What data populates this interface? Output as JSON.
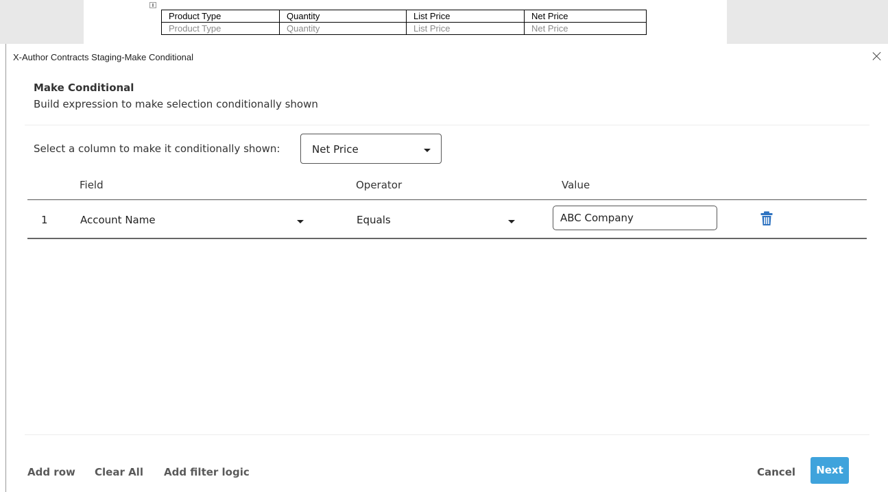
{
  "document": {
    "table": [
      [
        "Product Type",
        "Quantity",
        "List Price",
        "Net Price"
      ],
      [
        "Product Type",
        "Quantity",
        "List Price",
        "Net Price"
      ]
    ]
  },
  "dialog": {
    "title": "X-Author Contracts Staging-Make Conditional",
    "heading": "Make Conditional",
    "subheading": "Build expression to make selection conditionally shown",
    "column_label": "Select a column to make it conditionally shown:",
    "column_selected": "Net Price",
    "headers": {
      "field": "Field",
      "operator": "Operator",
      "value": "Value"
    },
    "rows": [
      {
        "num": "1",
        "field": "Account Name",
        "operator": "Equals",
        "value": "ABC Company"
      }
    ],
    "footer": {
      "add_row": "Add row",
      "clear_all": "Clear All",
      "add_filter_logic": "Add filter logic",
      "cancel": "Cancel",
      "next": "Next"
    }
  },
  "icons": {
    "close": "close-icon",
    "delete": "trash-icon",
    "dropdown": "caret-down-icon"
  },
  "colors": {
    "primary": "#3fa3dc",
    "delete_icon": "#2d72c0"
  }
}
